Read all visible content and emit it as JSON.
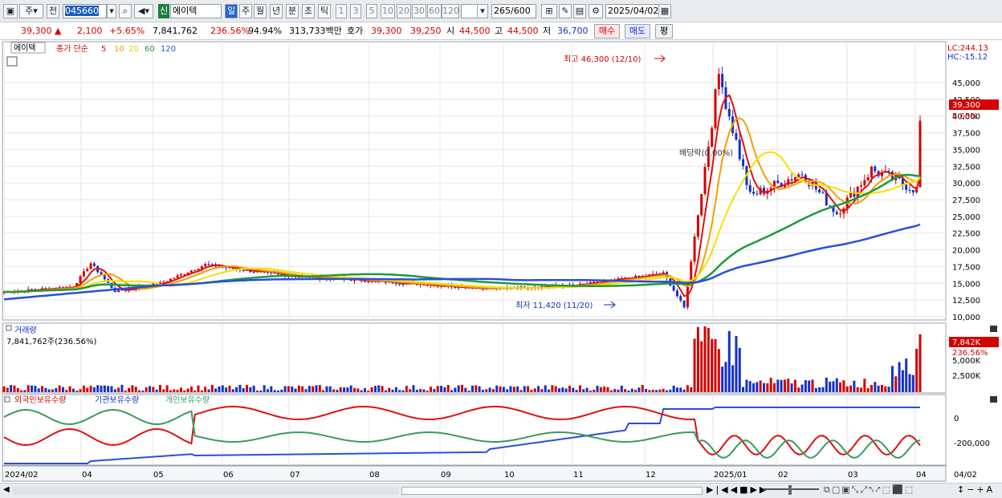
{
  "toolbar": {
    "period_btn": "주",
    "prev_btn": "전",
    "code": "045660",
    "new_badge": "신",
    "name": "에이텍",
    "p_day": "일",
    "p_week": "주",
    "p_month": "월",
    "p_year": "년",
    "p_min": "분",
    "p_sec": "초",
    "p_tick": "틱",
    "intervals": [
      "1",
      "3",
      "5",
      "10",
      "20",
      "30",
      "60",
      "120"
    ],
    "count": "265",
    "count_total": "/600",
    "date": "2025/04/02"
  },
  "quote": {
    "price": "39,300",
    "arrow": "▲",
    "change": "2,100",
    "change_pct": "+5.65%",
    "volume": "7,841,762",
    "vol_ratio": "236.56%",
    "turnover_ratio": "94.94%",
    "amount": "313,733백만",
    "hoga_label": "호가",
    "ask": "39,300",
    "bid": "39,250",
    "open_label": "시",
    "open": "44,500",
    "high_label": "고",
    "high": "44,500",
    "low_label": "저",
    "low": "36,700",
    "buy_btn": "매수",
    "sell_btn": "매도",
    "eval_btn": "평"
  },
  "colors": {
    "up": "#d40000",
    "down": "#1530c8",
    "ma5": "#e01010",
    "ma10": "#f0a000",
    "ma20": "#f5e000",
    "ma60": "#1f9a3a",
    "ma120": "#2a4fd8",
    "foreign": "#e01010",
    "inst": "#2a4fd8",
    "indiv": "#3a9a60"
  },
  "price_panel": {
    "name_tag": "에이텍",
    "legend_title": "종가 단순",
    "ma": [
      "5",
      "10",
      "20",
      "60",
      "120"
    ],
    "lc": "LC:244.13",
    "hc": "HC:-15.12",
    "last_price": "39,300",
    "last_pct": "5.65%",
    "high_annot": "최고 46,300 (12/10)",
    "low_annot": "최저 11,420 (11/20)",
    "mid_annot": "배당락(0.00%)",
    "y_ticks": [
      "45,000",
      "42,500",
      "40,000",
      "37,500",
      "35,000",
      "32,500",
      "30,000",
      "27,500",
      "25,000",
      "22,500",
      "20,000",
      "17,500",
      "15,000",
      "12,500",
      "10,000"
    ]
  },
  "volume_panel": {
    "title": "거래량",
    "value_text": "7,841,762주(236.56%)",
    "last_vol": "7,842K",
    "last_pct": "236.56%",
    "y_ticks": [
      "5,000K",
      "2,500K"
    ]
  },
  "holdings_panel": {
    "foreign": "외국인보유수량",
    "inst": "기관보유수량",
    "indiv": "개인보유수량",
    "y_ticks": [
      "0",
      "-200,000"
    ]
  },
  "x_axis": {
    "labels": [
      "2024/02",
      "04",
      "05",
      "06",
      "07",
      "08",
      "09",
      "10",
      "11",
      "12",
      "2025/01",
      "02",
      "03",
      "04"
    ],
    "right_date": "04/02"
  },
  "chart_data": {
    "type": "line",
    "title": "에이텍",
    "y_range": [
      10000,
      46300
    ],
    "x_range": [
      "2024/02",
      "2025/04/02"
    ],
    "high": {
      "value": 46300,
      "date": "12/10"
    },
    "low": {
      "value": 11420,
      "date": "11/20"
    },
    "series": [
      {
        "name": "종가",
        "x": [
          "02",
          "03",
          "04",
          "04 mid",
          "05",
          "06",
          "07",
          "08",
          "09",
          "10",
          "11",
          "11/20",
          "12/10",
          "12 end",
          "01",
          "02",
          "03",
          "04"
        ],
        "values": [
          13700,
          14500,
          18000,
          13800,
          15000,
          17800,
          16200,
          15200,
          14200,
          14700,
          16500,
          11420,
          46300,
          28000,
          31500,
          25500,
          32000,
          39300
        ]
      },
      {
        "name": "MA120",
        "x": [
          "02",
          "06",
          "10",
          "12",
          "01",
          "02",
          "03",
          "04"
        ],
        "values": [
          12600,
          14500,
          15400,
          15500,
          19500,
          22000,
          23500,
          24700
        ]
      }
    ]
  }
}
